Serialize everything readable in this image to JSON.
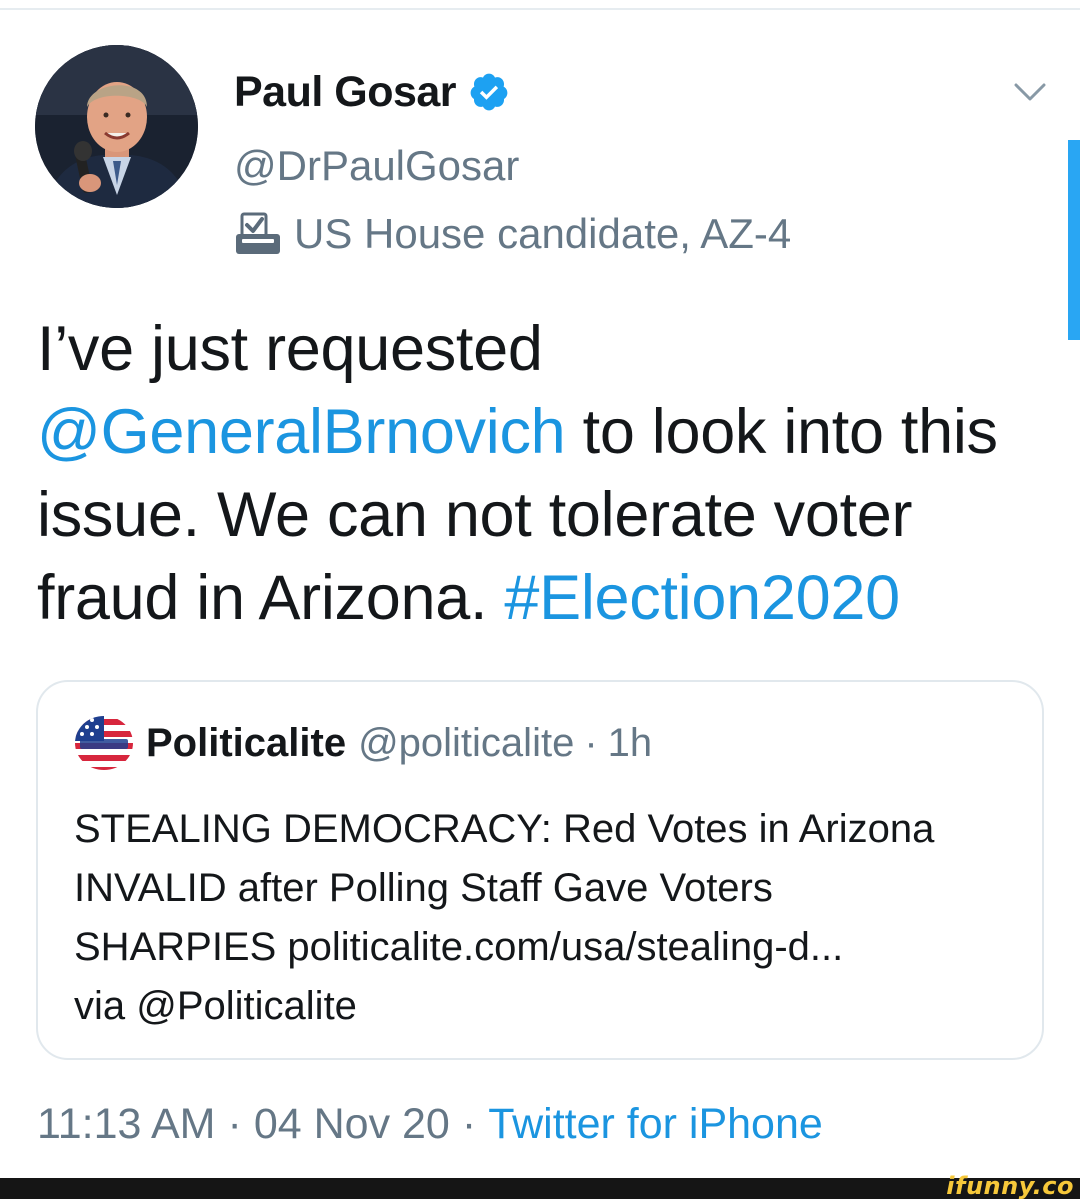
{
  "profile": {
    "display_name": "Paul Gosar",
    "handle": "@DrPaulGosar",
    "bio": "US House candidate, AZ-4",
    "verified_icon": "verified-badge-icon",
    "bio_icon": "ballot-box-icon",
    "menu_icon": "chevron-down-icon"
  },
  "tweet": {
    "line1": "I’ve just requested",
    "mention": "@GeneralBrnovich",
    "line2_rest": " to look into this",
    "line3": "issue.  We can not tolerate voter",
    "line4_start": "fraud in Arizona.  ",
    "hashtag": "#Election2020"
  },
  "quoted_tweet": {
    "author_name": "Politicalite",
    "author_handle": "@politicalite",
    "separator": "·",
    "time_ago": "1h",
    "line1": "STEALING DEMOCRACY: Red Votes in Arizona",
    "line2": "INVALID after Polling Staff Gave Voters",
    "line3": "SHARPIES  politicalite.com/usa/stealing-d...",
    "line4": "via @Politicalite"
  },
  "meta": {
    "time": "11:13 AM",
    "separator": "·",
    "date": "04 Nov 20",
    "source": "Twitter for iPhone"
  },
  "watermark": "ifunny.co",
  "colors": {
    "link_blue": "#1b95e0",
    "secondary_gray": "#657786",
    "verified_blue": "#1da1f2",
    "text_dark": "#14171a"
  }
}
